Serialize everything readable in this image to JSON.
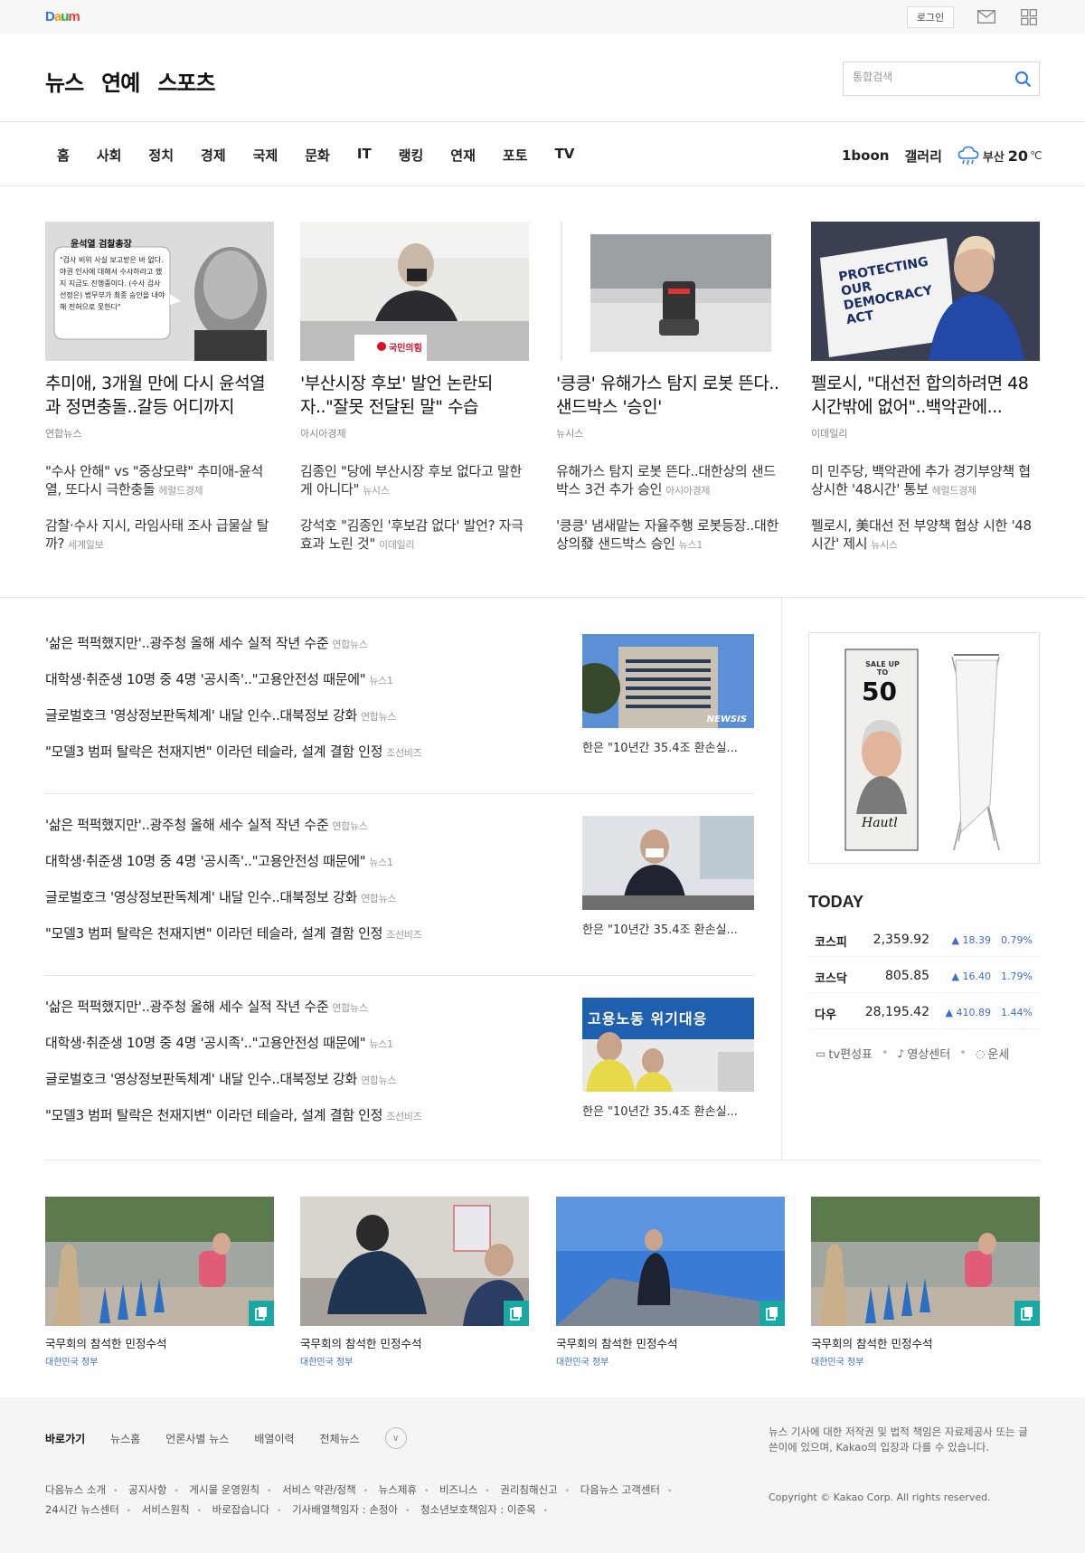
{
  "topbar": {
    "logo": [
      "D",
      "a",
      "u",
      "m"
    ],
    "login": "로그인"
  },
  "header": {
    "service_tabs": [
      "뉴스",
      "연예",
      "스포츠"
    ],
    "search_placeholder": "통합검색"
  },
  "gnb": {
    "menu": [
      "홈",
      "사회",
      "정치",
      "경제",
      "국제",
      "문화",
      "IT",
      "랭킹",
      "연재",
      "포토",
      "TV"
    ],
    "right": [
      "1boon",
      "갤러리"
    ],
    "weather": {
      "city": "부산",
      "temp": "20",
      "unit": "℃",
      "icon": "rain-cloud-icon"
    }
  },
  "headlines": [
    {
      "title": "추미애, 3개월 만에 다시 윤석열과 정면충돌..갈등 어디까지",
      "source": "연합뉴스",
      "thumb_caption": "윤석열 검찰총장",
      "thumb_quote": "\"검사 비위 사실 보고받은 바 없다. 야권 인사에 대해서 수사하라고 했지 지금도 진행중이다. (수사 검사 선정은) 법무부가 최종 승인을 내야 해 전혀으로 못한다\"",
      "subs": [
        {
          "text": "\"수사 안해\" vs \"중상모략\" 추미애-윤석열, 또다시 극한충돌",
          "src": "헤럴드경제"
        },
        {
          "text": "감찰·수사 지시, 라임사태 조사 급물살 탈까?",
          "src": "세계일보"
        }
      ]
    },
    {
      "title": "'부산시장 후보' 발언 논란되자..\"잘못 전달된 말\" 수습",
      "source": "아시아경제",
      "thumb_caption": "국민의힘",
      "subs": [
        {
          "text": "김종인 \"당에 부산시장 후보 없다고 말한 게 아니다\"",
          "src": "뉴시스"
        },
        {
          "text": "강석호 \"김종인 '후보감 없다' 발언? 자극효과 노린 것\"",
          "src": "이데일리"
        }
      ]
    },
    {
      "title": "'킁킁' 유해가스 탐지 로봇 뜬다..샌드박스 '승인'",
      "source": "뉴시스",
      "subs": [
        {
          "text": "유해가스 탐지 로봇 뜬다..대한상의 샌드박스 3건 추가 승인",
          "src": "아시아경제"
        },
        {
          "text": "'킁킁' 냄새맡는 자율주행 로봇등장..대한상의發 샌드박스 승인",
          "src": "뉴스1"
        }
      ]
    },
    {
      "title": "펠로시, \"대선전 합의하려면 48시간밖에 없어\"..백악관에...",
      "source": "이데일리",
      "thumb_caption": "PROTECTING OUR DEMOCRACY ACT",
      "subs": [
        {
          "text": "미 민주당, 백악관에 추가 경기부양책 협상시한 '48시간' 통보",
          "src": "헤럴드경제"
        },
        {
          "text": "펠로시, 美대선 전 부양책 협상 시한 '48시간' 제시",
          "src": "뉴시스"
        }
      ]
    }
  ],
  "mid_sections": [
    {
      "items": [
        {
          "text": "'삶은 퍽퍽했지만'..광주청 올해 세수 실적 작년 수준",
          "src": "연합뉴스"
        },
        {
          "text": "대학생·취준생 10명 중 4명 '공시족'..\"고용안전성 때문에\"",
          "src": "뉴스1"
        },
        {
          "text": "글로벌호크 '영상정보판독체계' 내달 인수..대북정보 강화",
          "src": "연합뉴스"
        },
        {
          "text": "\"모델3 범퍼 탈락은 천재지변\" 이라던 테슬라, 설계 결함 인정",
          "src": "조선비즈"
        }
      ],
      "caption": "한은 \"10년간 35.4조 환손실...",
      "photo_label": "NEWSIS"
    },
    {
      "items": [
        {
          "text": "'삶은 퍽퍽했지만'..광주청 올해 세수 실적 작년 수준",
          "src": "연합뉴스"
        },
        {
          "text": "대학생·취준생 10명 중 4명 '공시족'..\"고용안전성 때문에\"",
          "src": "뉴스1"
        },
        {
          "text": "글로벌호크 '영상정보판독체계' 내달 인수..대북정보 강화",
          "src": "연합뉴스"
        },
        {
          "text": "\"모델3 범퍼 탈락은 천재지변\" 이라던 테슬라, 설계 결함 인정",
          "src": "조선비즈"
        }
      ],
      "caption": "한은 \"10년간 35.4조 환손실..."
    },
    {
      "items": [
        {
          "text": "'삶은 퍽퍽했지만'..광주청 올해 세수 실적 작년 수준",
          "src": "연합뉴스"
        },
        {
          "text": "대학생·취준생 10명 중 4명 '공시족'..\"고용안전성 때문에\"",
          "src": "뉴스1"
        },
        {
          "text": "글로벌호크 '영상정보판독체계' 내달 인수..대북정보 강화",
          "src": "연합뉴스"
        },
        {
          "text": "\"모델3 범퍼 탈락은 천재지변\" 이라던 테슬라, 설계 결함 인정",
          "src": "조선비즈"
        }
      ],
      "caption": "한은 \"10년간 35.4조 환손실...",
      "photo_label": "고용노동 위기대응"
    }
  ],
  "ad": {
    "sale": "SALE UP TO",
    "value": "50",
    "brand": "Hautl"
  },
  "today": {
    "title": "TODAY",
    "stocks": [
      {
        "name": "코스피",
        "value": "2,359.92",
        "change": "▲ 18.39",
        "pct": "0.79%"
      },
      {
        "name": "코스닥",
        "value": "805.85",
        "change": "▲ 16.40",
        "pct": "1.79%"
      },
      {
        "name": "다우",
        "value": "28,195.42",
        "change": "▲ 410.89",
        "pct": "1.44%"
      }
    ],
    "links": [
      "tv편성표",
      "영상센터",
      "운세"
    ]
  },
  "photos": [
    {
      "caption": "국무회의 참석한 민정수석",
      "org": "대한민국 정부"
    },
    {
      "caption": "국무회의 참석한 민정수석",
      "org": "대한민국 정부"
    },
    {
      "caption": "국무회의 참석한 민정수석",
      "org": "대한민국 정부"
    },
    {
      "caption": "국무회의 참석한 민정수석",
      "org": "대한민국 정부"
    }
  ],
  "footer": {
    "nav": [
      "바로가기",
      "뉴스홈",
      "언론사별 뉴스",
      "배열이력",
      "전체뉴스"
    ],
    "links": [
      "다음뉴스 소개",
      "공지사항",
      "게시물 운영원칙",
      "서비스 약관/정책",
      "뉴스제휴",
      "비즈니스",
      "권리침해신고",
      "다음뉴스 고객센터",
      "24시간 뉴스센터",
      "서비스원칙",
      "바로잡습니다",
      "기사배열책임자 : 손정아",
      "청소년보호책임자 : 이준목"
    ],
    "notice": "뉴스 기사에 대한 저작권 및 법적 책임은 자료제공사 또는 글쓴이에 있으며, Kakao의 입장과 다를 수 있습니다.",
    "copyright": "Copyright © Kakao Corp. All rights reserved."
  }
}
